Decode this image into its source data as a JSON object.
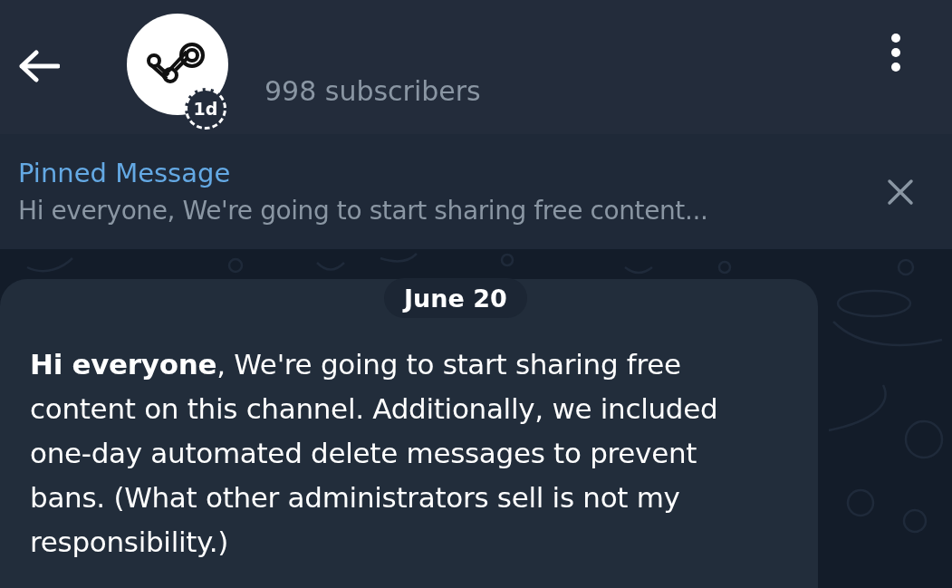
{
  "header": {
    "badge": "1d",
    "subscribers": "998 subscribers"
  },
  "pinned": {
    "title": "Pinned Message",
    "text": "Hi everyone, We're going to start sharing free content..."
  },
  "date": "June 20",
  "message": {
    "text": "**Hi everyone**, We're going to start sharing free content on this channel. Additionally, we included one-day automated delete messages to prevent bans. (What other administrators sell is not my responsibility.)"
  }
}
